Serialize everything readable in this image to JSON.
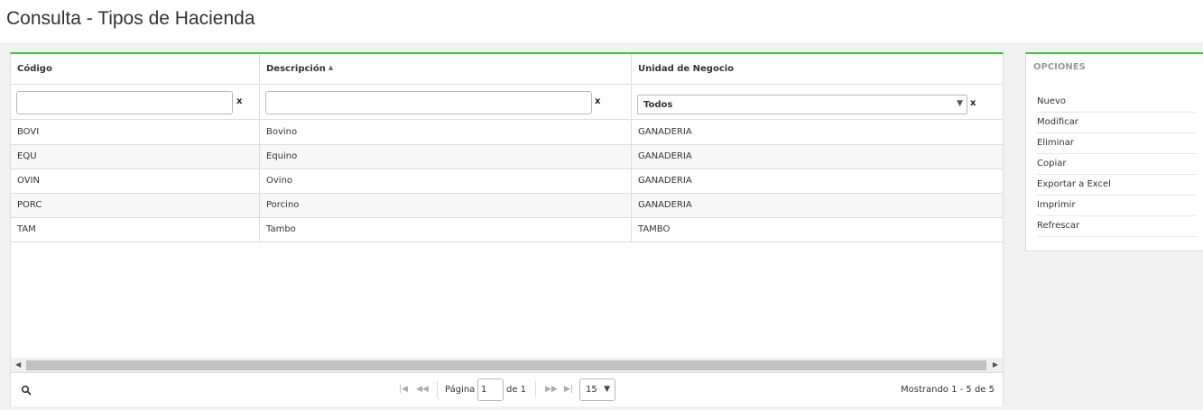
{
  "page": {
    "title": "Consulta - Tipos de Hacienda"
  },
  "grid": {
    "columns": [
      {
        "label": "Código"
      },
      {
        "label": "Descripción",
        "sorted": "asc"
      },
      {
        "label": "Unidad de Negocio"
      }
    ],
    "filters": {
      "codigo": "",
      "descripcion": "",
      "unidad": "Todos",
      "clear_label": "x"
    },
    "rows": [
      {
        "codigo": "BOVI",
        "descripcion": "Bovino",
        "unidad": "GANADERIA"
      },
      {
        "codigo": "EQU",
        "descripcion": "Equino",
        "unidad": "GANADERIA"
      },
      {
        "codigo": "OVIN",
        "descripcion": "Ovino",
        "unidad": "GANADERIA"
      },
      {
        "codigo": "PORC",
        "descripcion": "Porcino",
        "unidad": "GANADERIA"
      },
      {
        "codigo": "TAM",
        "descripcion": "Tambo",
        "unidad": "TAMBO"
      }
    ]
  },
  "pager": {
    "page_label": "Página",
    "page_value": "1",
    "of_label": "de 1",
    "page_size": "15",
    "info": "Mostrando 1 - 5 de 5"
  },
  "options": {
    "title": "OPCIONES",
    "items": [
      "Nuevo",
      "Modificar",
      "Eliminar",
      "Copiar",
      "Exportar a Excel",
      "Imprimir",
      "Refrescar"
    ]
  },
  "colors": {
    "accent": "#2ecc2e"
  }
}
